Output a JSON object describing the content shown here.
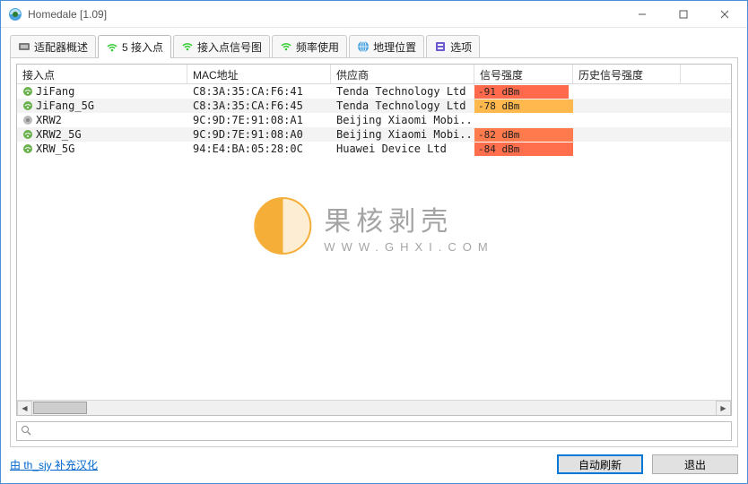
{
  "window": {
    "title": "Homedale [1.09]"
  },
  "tabs": [
    {
      "label": "适配器概述"
    },
    {
      "label": "5 接入点",
      "active": true
    },
    {
      "label": "接入点信号图"
    },
    {
      "label": "频率使用"
    },
    {
      "label": "地理位置"
    },
    {
      "label": "选项"
    }
  ],
  "columns": {
    "ap": "接入点",
    "mac": "MAC地址",
    "vendor": "供应商",
    "signal": "信号强度",
    "history": "历史信号强度"
  },
  "rows": [
    {
      "name": "JiFang",
      "mac": "C8:3A:35:CA:F6:41",
      "vendor": "Tenda Technology Ltd",
      "signal": "-91 dBm",
      "color": "#ff6a4d",
      "ratio": 0.95,
      "icon": "wifi"
    },
    {
      "name": "JiFang_5G",
      "mac": "C8:3A:35:CA:F6:45",
      "vendor": "Tenda Technology Ltd",
      "signal": "-78 dBm",
      "color": "#ffb84d",
      "ratio": 1.0,
      "icon": "wifi",
      "alt": true
    },
    {
      "name": "XRW2",
      "mac": "9C:9D:7E:91:08:A1",
      "vendor": "Beijing Xiaomi Mobi...",
      "signal": "",
      "color": "",
      "ratio": 0,
      "icon": "dim"
    },
    {
      "name": "XRW2_5G",
      "mac": "9C:9D:7E:91:08:A0",
      "vendor": "Beijing Xiaomi Mobi...",
      "signal": "-82 dBm",
      "color": "#ff7a4d",
      "ratio": 1.0,
      "icon": "wifi",
      "alt": true
    },
    {
      "name": "XRW_5G",
      "mac": "94:E4:BA:05:28:0C",
      "vendor": "Huawei Device Ltd",
      "signal": "-84 dBm",
      "color": "#ff6f4d",
      "ratio": 1.0,
      "icon": "wifi"
    }
  ],
  "footer": {
    "link": "由 th_sjy 补充汉化",
    "refresh": "自动刷新",
    "exit": "退出"
  },
  "watermark": {
    "cn": "果核剥壳",
    "en": "WWW.GHXI.COM"
  },
  "search": {
    "placeholder": ""
  }
}
